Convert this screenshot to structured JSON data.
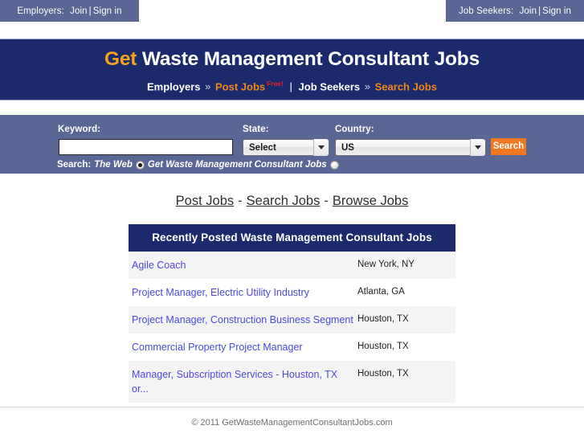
{
  "topbar": {
    "employers": {
      "label": "Employers:",
      "join": "Join",
      "separator": "|",
      "signin": "Sign in"
    },
    "jobseekers": {
      "label": "Job Seekers:",
      "join": "Join",
      "separator": "|",
      "signin": "Sign in"
    }
  },
  "banner": {
    "title_accent": "Get",
    "title_rest": "Waste Management Consultant Jobs",
    "subnav": {
      "employers": "Employers",
      "chevron1": "»",
      "post_jobs": "Post Jobs",
      "free_badge": "Free!",
      "pipe": "|",
      "job_seekers": "Job Seekers",
      "chevron2": "»",
      "search_jobs": "Search Jobs"
    }
  },
  "search": {
    "keyword_label": "Keyword:",
    "keyword_value": "",
    "keyword_placeholder": "",
    "state_label": "State:",
    "state_value": "Select",
    "country_label": "Country:",
    "country_value": "US",
    "search_button": "Search",
    "mode_label": "Search:",
    "mode_web": "The Web",
    "mode_site": "Get Waste Management Consultant Jobs",
    "mode_web_selected": true,
    "mode_site_selected": false
  },
  "midlinks": {
    "post_jobs": "Post Jobs",
    "dash1": "-",
    "search_jobs": "Search Jobs",
    "dash2": "-",
    "browse_jobs": "Browse Jobs"
  },
  "jobs": {
    "heading": "Recently Posted Waste Management Consultant Jobs",
    "rows": [
      {
        "title": "Agile Coach",
        "location": "New York, NY"
      },
      {
        "title": "Project Manager, Electric Utility Industry",
        "location": "Atlanta, GA"
      },
      {
        "title": "Project Manager, Construction Business Segment",
        "location": "Houston, TX"
      },
      {
        "title": "Commercial Property Project Manager",
        "location": "Houston, TX"
      },
      {
        "title": "Manager, Subscription Services - Houston, TX or...",
        "location": "Houston, TX"
      }
    ]
  },
  "footer": {
    "copyright": "© 2011 GetWasteManagementConsultantJobs.com"
  },
  "colors": {
    "navy": "#1b2a6b",
    "slate": "#5a6794",
    "orange": "#f07822",
    "accent_gold": "#f5a11e",
    "free_red": "#e82020",
    "link_blue": "#4a4ae0"
  }
}
